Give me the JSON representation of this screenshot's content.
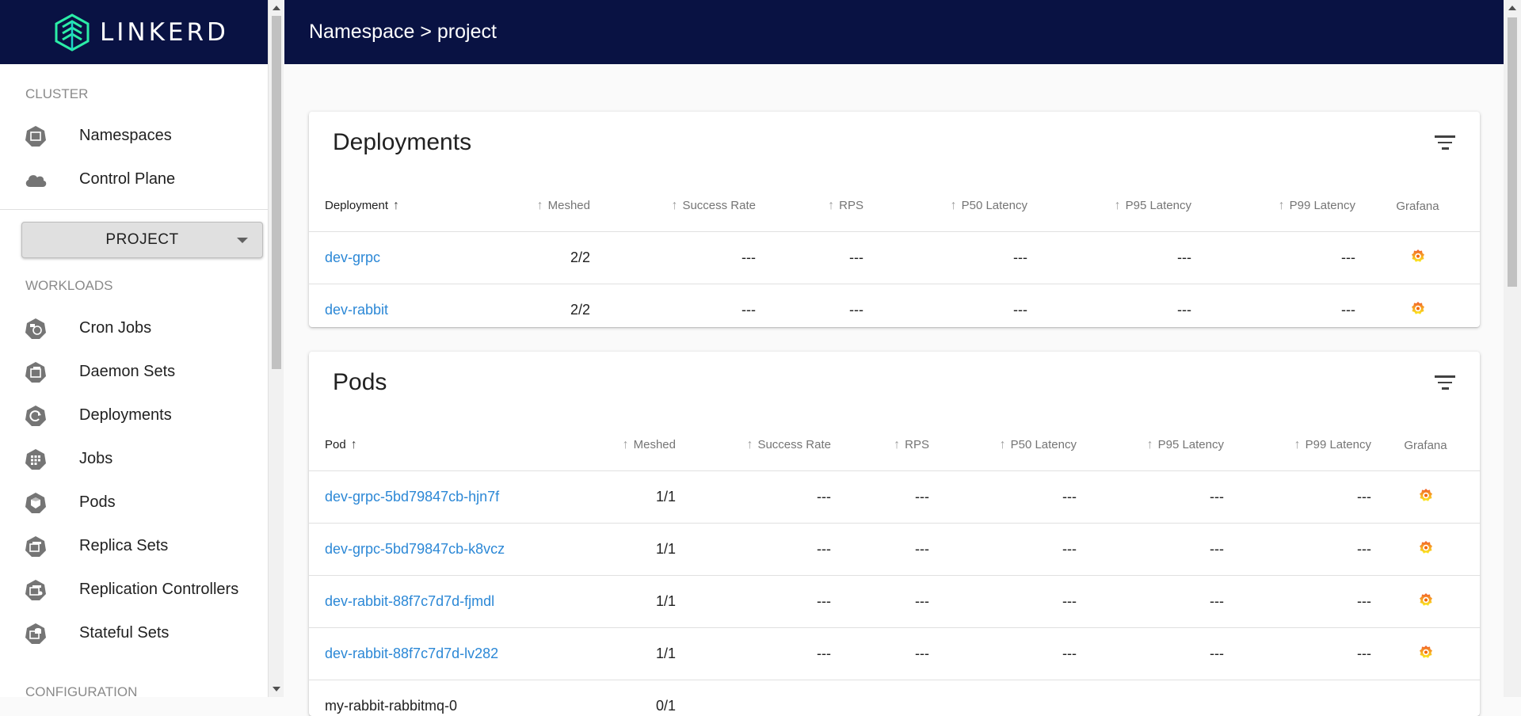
{
  "brand": {
    "name": "LINKERD"
  },
  "breadcrumb": "Namespace > project",
  "sidebar": {
    "cluster_title": "CLUSTER",
    "cluster_items": [
      {
        "label": "Namespaces",
        "icon": "namespace-icon"
      },
      {
        "label": "Control Plane",
        "icon": "cloud-icon"
      }
    ],
    "namespace_select": "PROJECT",
    "workloads_title": "WORKLOADS",
    "workload_items": [
      {
        "label": "Cron Jobs",
        "icon": "cronjob-icon"
      },
      {
        "label": "Daemon Sets",
        "icon": "daemonset-icon"
      },
      {
        "label": "Deployments",
        "icon": "deployment-icon"
      },
      {
        "label": "Jobs",
        "icon": "job-icon"
      },
      {
        "label": "Pods",
        "icon": "pod-icon"
      },
      {
        "label": "Replica Sets",
        "icon": "replicaset-icon"
      },
      {
        "label": "Replication Controllers",
        "icon": "replication-controller-icon"
      },
      {
        "label": "Stateful Sets",
        "icon": "statefulset-icon"
      }
    ],
    "configuration_title": "CONFIGURATION"
  },
  "deployments": {
    "title": "Deployments",
    "columns": [
      "Deployment",
      "Meshed",
      "Success Rate",
      "RPS",
      "P50 Latency",
      "P95 Latency",
      "P99 Latency",
      "Grafana"
    ],
    "rows": [
      {
        "name": "dev-grpc",
        "meshed": "2/2",
        "success_rate": "---",
        "rps": "---",
        "p50": "---",
        "p95": "---",
        "p99": "---"
      },
      {
        "name": "dev-rabbit",
        "meshed": "2/2",
        "success_rate": "---",
        "rps": "---",
        "p50": "---",
        "p95": "---",
        "p99": "---"
      }
    ]
  },
  "pods": {
    "title": "Pods",
    "columns": [
      "Pod",
      "Meshed",
      "Success Rate",
      "RPS",
      "P50 Latency",
      "P95 Latency",
      "P99 Latency",
      "Grafana"
    ],
    "rows": [
      {
        "name": "dev-grpc-5bd79847cb-hjn7f",
        "meshed": "1/1",
        "success_rate": "---",
        "rps": "---",
        "p50": "---",
        "p95": "---",
        "p99": "---"
      },
      {
        "name": "dev-grpc-5bd79847cb-k8vcz",
        "meshed": "1/1",
        "success_rate": "---",
        "rps": "---",
        "p50": "---",
        "p95": "---",
        "p99": "---"
      },
      {
        "name": "dev-rabbit-88f7c7d7d-fjmdl",
        "meshed": "1/1",
        "success_rate": "---",
        "rps": "---",
        "p50": "---",
        "p95": "---",
        "p99": "---"
      },
      {
        "name": "dev-rabbit-88f7c7d7d-lv282",
        "meshed": "1/1",
        "success_rate": "---",
        "rps": "---",
        "p50": "---",
        "p95": "---",
        "p99": "---"
      },
      {
        "name": "my-rabbit-rabbitmq-0",
        "meshed": "0/1",
        "success_rate": "",
        "rps": "",
        "p50": "",
        "p95": "",
        "p99": ""
      }
    ]
  },
  "colors": {
    "navy": "#091243",
    "link": "#2c88d6",
    "grafana_orange": "#f46800"
  }
}
